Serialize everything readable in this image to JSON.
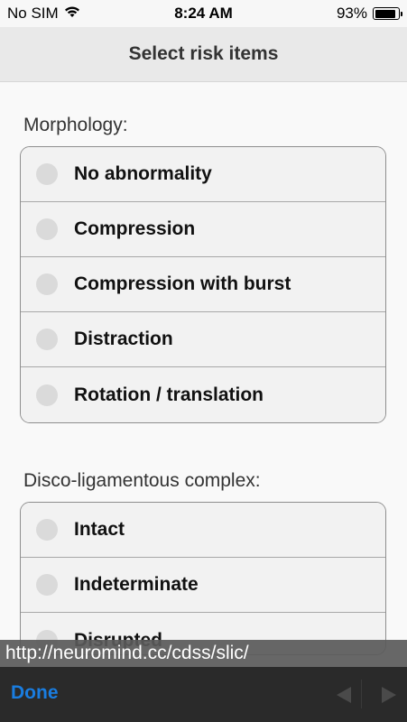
{
  "status_bar": {
    "carrier": "No SIM",
    "time": "8:24 AM",
    "battery_text": "93%",
    "battery_level": 0.93
  },
  "header": {
    "title": "Select risk items"
  },
  "sections": [
    {
      "label": "Morphology:",
      "options": [
        "No abnormality",
        "Compression",
        "Compression with burst",
        "Distraction",
        "Rotation / translation"
      ]
    },
    {
      "label": "Disco-ligamentous complex:",
      "options": [
        "Intact",
        "Indeterminate",
        "Disrupted"
      ]
    }
  ],
  "browser": {
    "url": "http://neuromind.cc/cdss/slic/",
    "done_label": "Done"
  },
  "colors": {
    "accent": "#1a7de0",
    "header_bg": "#e9e9e9",
    "bottom_bar_bg": "#2a2a2a"
  }
}
